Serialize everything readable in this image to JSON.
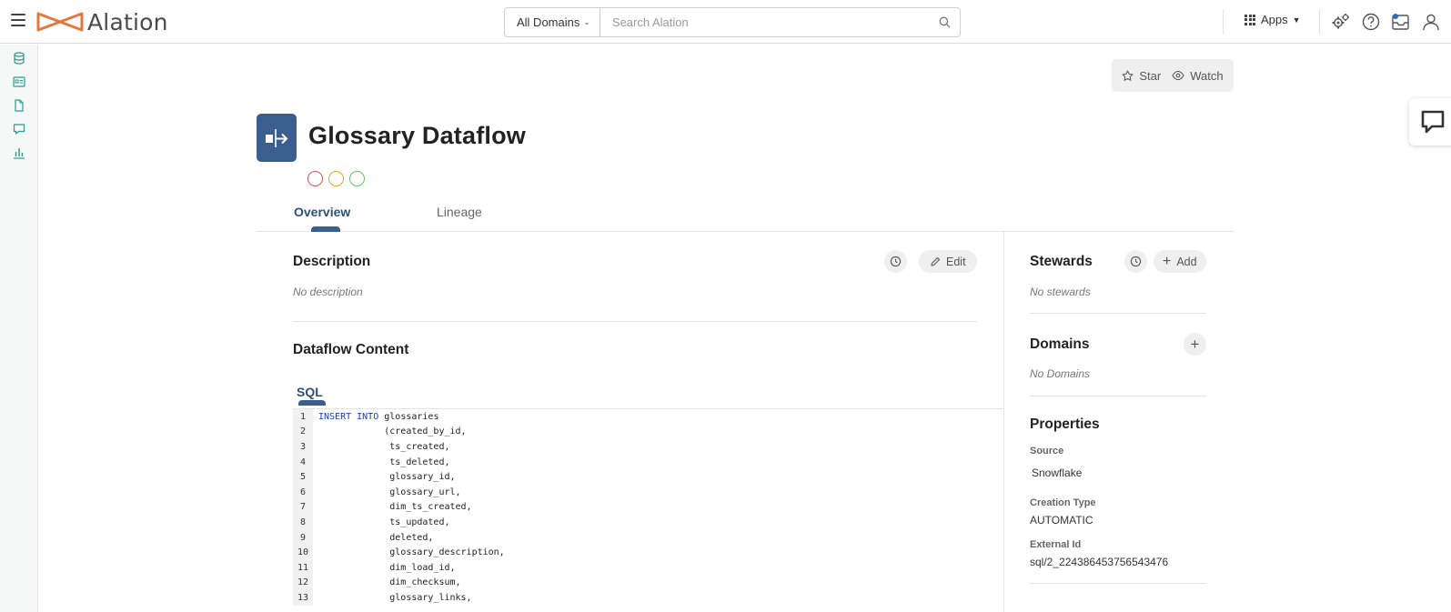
{
  "topbar": {
    "logo_text": "Alation",
    "domain_select": "All Domains",
    "search_placeholder": "Search Alation",
    "apps_label": "Apps"
  },
  "actions": {
    "star_label": "Star",
    "watch_label": "Watch"
  },
  "header": {
    "title": "Glossary Dataflow",
    "status_colors": [
      "#d9534f",
      "#e8a13a",
      "#6abf69"
    ]
  },
  "tabs": [
    {
      "label": "Overview",
      "active": true
    },
    {
      "label": "Lineage",
      "active": false
    }
  ],
  "description": {
    "title": "Description",
    "empty": "No description",
    "edit_label": "Edit"
  },
  "dataflow": {
    "title": "Dataflow Content",
    "tab_label": "SQL",
    "lines": [
      {
        "num": "1",
        "kw": "INSERT INTO",
        "text": " glossaries"
      },
      {
        "num": "2",
        "kw": "",
        "text": "            (created_by_id,"
      },
      {
        "num": "3",
        "kw": "",
        "text": "             ts_created,"
      },
      {
        "num": "4",
        "kw": "",
        "text": "             ts_deleted,"
      },
      {
        "num": "5",
        "kw": "",
        "text": "             glossary_id,"
      },
      {
        "num": "6",
        "kw": "",
        "text": "             glossary_url,"
      },
      {
        "num": "7",
        "kw": "",
        "text": "             dim_ts_created,"
      },
      {
        "num": "8",
        "kw": "",
        "text": "             ts_updated,"
      },
      {
        "num": "9",
        "kw": "",
        "text": "             deleted,"
      },
      {
        "num": "10",
        "kw": "",
        "text": "             glossary_description,"
      },
      {
        "num": "11",
        "kw": "",
        "text": "             dim_load_id,"
      },
      {
        "num": "12",
        "kw": "",
        "text": "             dim_checksum,"
      },
      {
        "num": "13",
        "kw": "",
        "text": "             glossary_links,"
      }
    ]
  },
  "stewards": {
    "title": "Stewards",
    "empty": "No stewards",
    "add_label": "Add"
  },
  "domains": {
    "title": "Domains",
    "empty": "No Domains"
  },
  "properties": {
    "title": "Properties",
    "source_label": "Source",
    "source_value": "Snowflake",
    "creation_type_label": "Creation Type",
    "creation_type_value": "AUTOMATIC",
    "external_id_label": "External Id",
    "external_id_value": "sql/2_224386453756543476"
  },
  "colors": {
    "accent": "#3a5f8f",
    "rail_icon": "#2a9d8f",
    "logo": "#e07a3f"
  }
}
